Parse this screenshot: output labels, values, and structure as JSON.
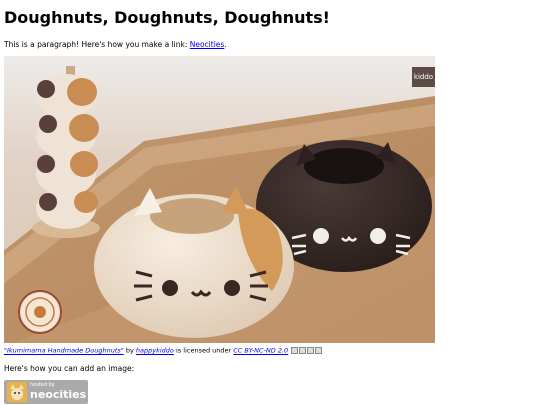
{
  "page": {
    "title": "Doughnuts, Doughnuts, Doughnuts!",
    "intro_text": "This is a paragraph! Here's how you make a link:",
    "intro_link": "Neocities",
    "intro_end": "."
  },
  "photo": {
    "watermark": "kiddo"
  },
  "caption": {
    "work_title": "\"Ikumimama Handmade Doughnuts\"",
    "by": "by",
    "author": "happykiddo",
    "licensed": "is licensed under",
    "license": "CC BY-NC-ND 2.0"
  },
  "image_text": "Here's how you can add an image:",
  "badge": {
    "hosted_by": "hosted by",
    "brand": "neocities"
  }
}
